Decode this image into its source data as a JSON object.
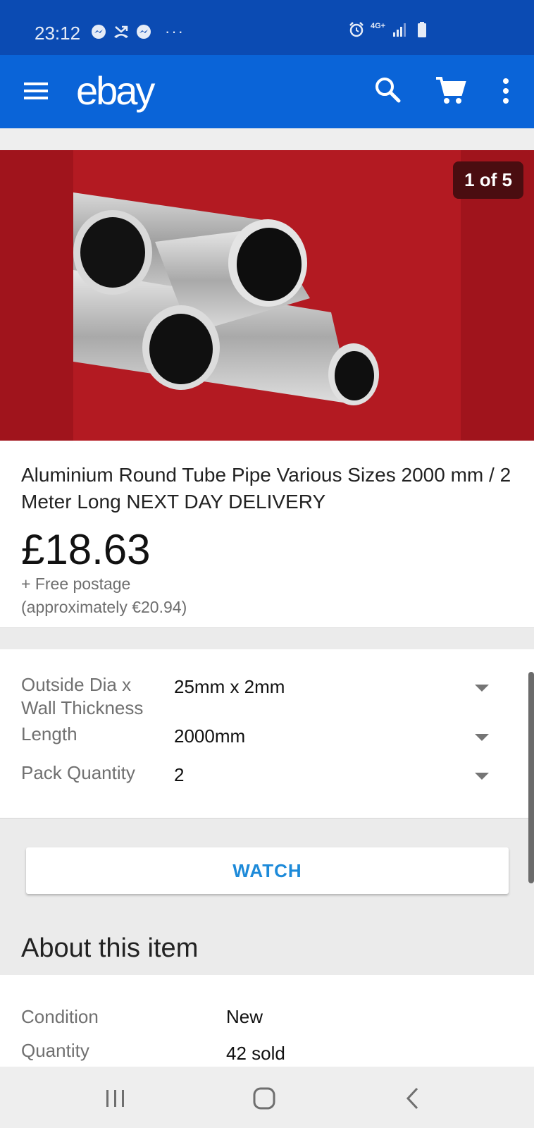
{
  "status_bar": {
    "time": "23:12",
    "left_icons": [
      "messenger-icon",
      "missed-call-icon",
      "messenger-icon",
      "more-notifications-icon"
    ],
    "right_icons": [
      "alarm-icon",
      "4g-plus-icon",
      "signal-icon",
      "battery-icon"
    ],
    "network": "4G+"
  },
  "app_bar": {
    "logo": "ebay",
    "icons": [
      "menu-icon",
      "search-icon",
      "cart-icon",
      "more-vert-icon"
    ]
  },
  "gallery": {
    "counter": "1 of 5"
  },
  "item": {
    "title": "Aluminium Round Tube Pipe Various Sizes 2000 mm / 2 Meter Long NEXT DAY DELIVERY",
    "price": "£18.63",
    "postage": "+ Free postage",
    "approx": "(approximately €20.94)"
  },
  "variations": [
    {
      "label": "Outside Dia x Wall Thickness",
      "value": "25mm x 2mm"
    },
    {
      "label": "Length",
      "value": "2000mm"
    },
    {
      "label": "Pack Quantity",
      "value": "2"
    }
  ],
  "watch_label": "WATCH",
  "about": {
    "heading": "About this item",
    "rows": [
      {
        "label": "Condition",
        "value": "New"
      },
      {
        "label": "Quantity",
        "value": "42 sold"
      }
    ]
  },
  "colors": {
    "status_bar": "#0b4bb3",
    "app_bar": "#0a64d8",
    "accent_link": "#1d8ad9",
    "hero_bg": "#a0141c"
  }
}
